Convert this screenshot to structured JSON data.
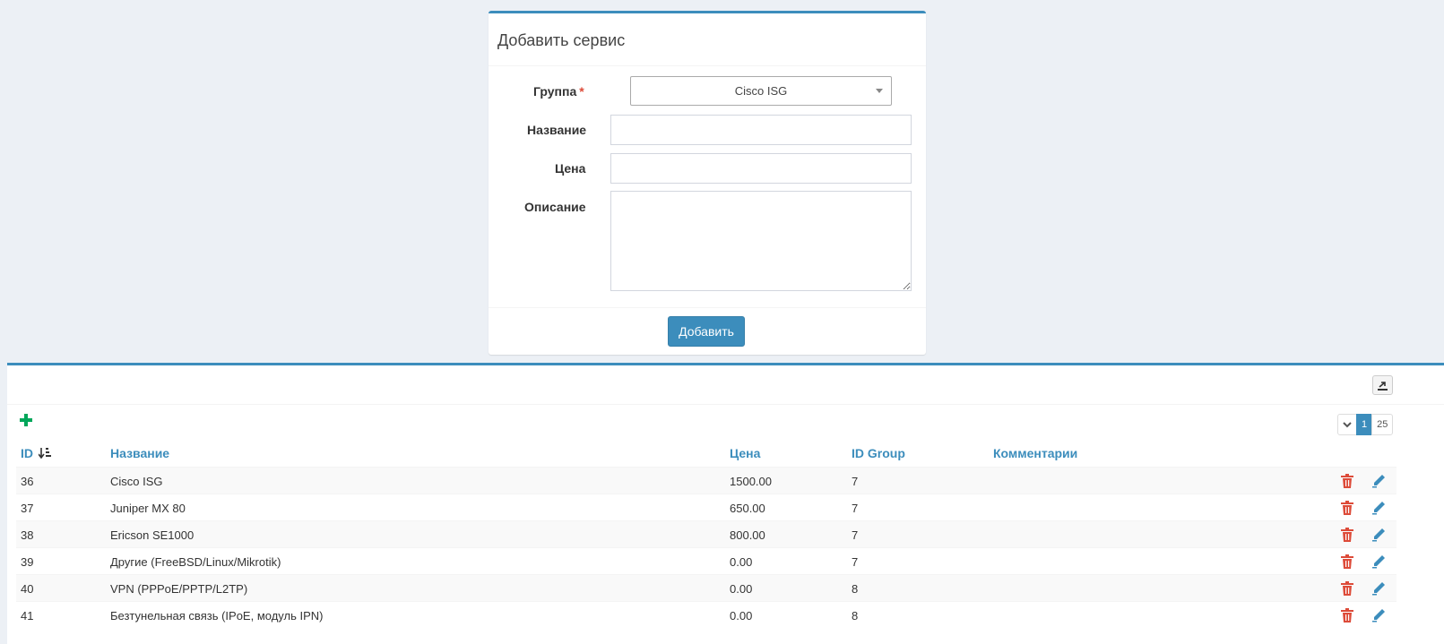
{
  "form": {
    "title": "Добавить сервис",
    "group_label": "Группа",
    "group_required": "*",
    "group_value": "Cisco ISG",
    "name_label": "Название",
    "name_value": "",
    "price_label": "Цена",
    "price_value": "",
    "desc_label": "Описание",
    "desc_value": "",
    "submit_label": "Добавить"
  },
  "table": {
    "pager": {
      "current_page": "1",
      "page_size": "25"
    },
    "headers": {
      "id": "ID",
      "name": "Название",
      "price": "Цена",
      "group": "ID Group",
      "comments": "Комментарии"
    },
    "rows": [
      {
        "id": "36",
        "name": "Cisco ISG",
        "price": "1500.00",
        "group": "7",
        "comment": ""
      },
      {
        "id": "37",
        "name": "Juniper MX 80",
        "price": "650.00",
        "group": "7",
        "comment": ""
      },
      {
        "id": "38",
        "name": "Ericson SE1000",
        "price": "800.00",
        "group": "7",
        "comment": ""
      },
      {
        "id": "39",
        "name": "Другие (FreeBSD/Linux/Mikrotik)",
        "price": "0.00",
        "group": "7",
        "comment": ""
      },
      {
        "id": "40",
        "name": "VPN (PPPoE/PPTP/L2TP)",
        "price": "0.00",
        "group": "8",
        "comment": ""
      },
      {
        "id": "41",
        "name": "Безтунельная связь (IPoE, модуль IPN)",
        "price": "0.00",
        "group": "8",
        "comment": ""
      }
    ]
  },
  "colors": {
    "accent": "#3c8dbc",
    "add": "#00a65a",
    "delete": "#dd4b39",
    "background": "#ecf0f5"
  },
  "icons": {
    "export": "export-icon",
    "add": "plus-icon",
    "sort": "sort-amount-down-icon",
    "delete": "trash-icon",
    "edit": "pencil-icon",
    "dropdown": "chevron-down-icon"
  }
}
